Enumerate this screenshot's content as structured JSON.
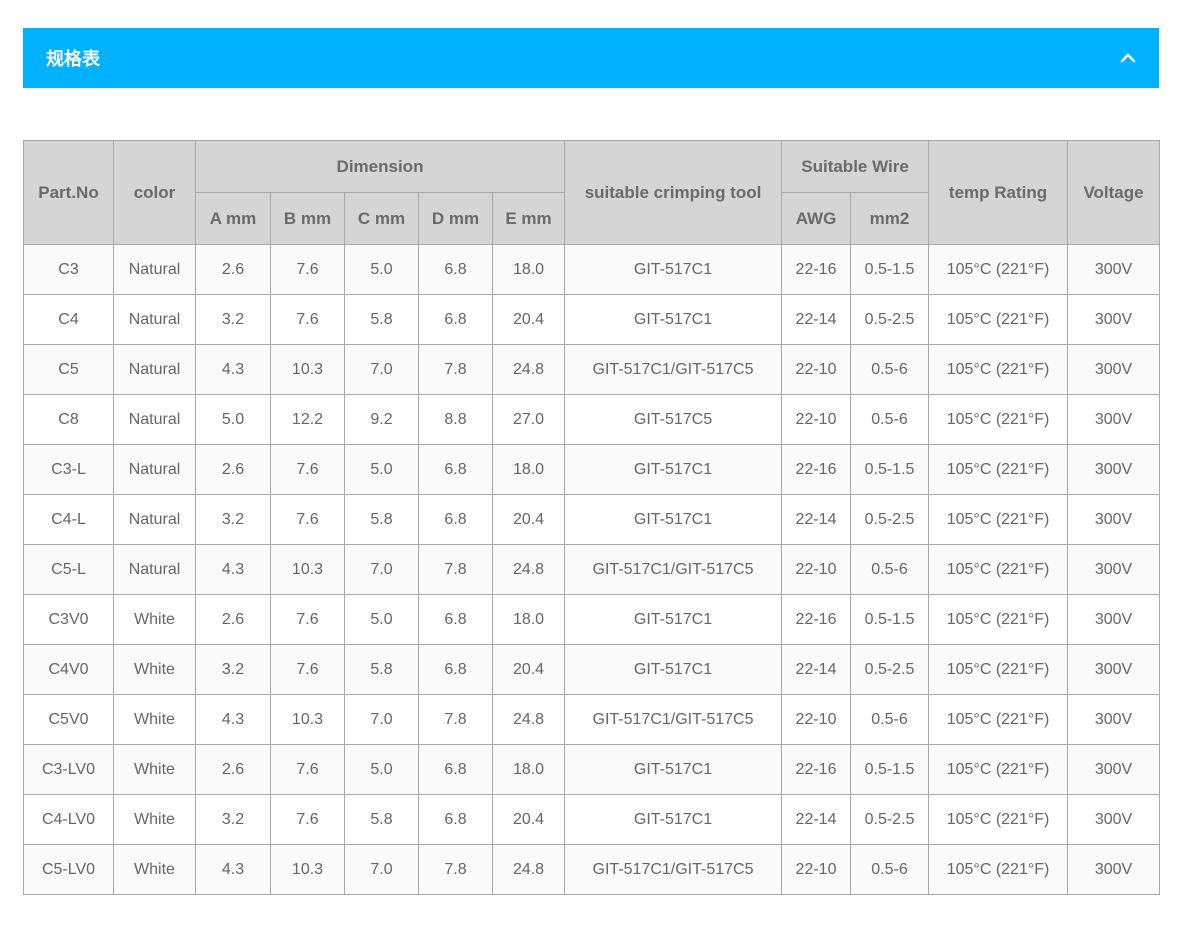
{
  "section": {
    "title": "规格表",
    "toggle_icon": "chevron-up-icon"
  },
  "colors": {
    "header_bg": "#00b1ff",
    "table_header_bg": "#d5d5d5",
    "border": "#a9a9a9"
  },
  "table": {
    "headers": {
      "part_no": "Part.No",
      "color": "color",
      "dimension": "Dimension",
      "crimp_tool": "suitable crimping tool",
      "suitable_wire": "Suitable Wire",
      "temp_rating": "temp Rating",
      "voltage": "Voltage",
      "a": "A mm",
      "b": "B mm",
      "c": "C mm",
      "d": "D mm",
      "e": "E mm",
      "awg": "AWG",
      "mm2": "mm2"
    },
    "rows": [
      [
        "C3",
        "Natural",
        "2.6",
        "7.6",
        "5.0",
        "6.8",
        "18.0",
        "GIT-517C1",
        "22-16",
        "0.5-1.5",
        "105°C (221°F)",
        "300V"
      ],
      [
        "C4",
        "Natural",
        "3.2",
        "7.6",
        "5.8",
        "6.8",
        "20.4",
        "GIT-517C1",
        "22-14",
        "0.5-2.5",
        "105°C (221°F)",
        "300V"
      ],
      [
        "C5",
        "Natural",
        "4.3",
        "10.3",
        "7.0",
        "7.8",
        "24.8",
        "GIT-517C1/GIT-517C5",
        "22-10",
        "0.5-6",
        "105°C (221°F)",
        "300V"
      ],
      [
        "C8",
        "Natural",
        "5.0",
        "12.2",
        "9.2",
        "8.8",
        "27.0",
        "GIT-517C5",
        "22-10",
        "0.5-6",
        "105°C (221°F)",
        "300V"
      ],
      [
        "C3-L",
        "Natural",
        "2.6",
        "7.6",
        "5.0",
        "6.8",
        "18.0",
        "GIT-517C1",
        "22-16",
        "0.5-1.5",
        "105°C (221°F)",
        "300V"
      ],
      [
        "C4-L",
        "Natural",
        "3.2",
        "7.6",
        "5.8",
        "6.8",
        "20.4",
        "GIT-517C1",
        "22-14",
        "0.5-2.5",
        "105°C (221°F)",
        "300V"
      ],
      [
        "C5-L",
        "Natural",
        "4.3",
        "10.3",
        "7.0",
        "7.8",
        "24.8",
        "GIT-517C1/GIT-517C5",
        "22-10",
        "0.5-6",
        "105°C (221°F)",
        "300V"
      ],
      [
        "C3V0",
        "White",
        "2.6",
        "7.6",
        "5.0",
        "6.8",
        "18.0",
        "GIT-517C1",
        "22-16",
        "0.5-1.5",
        "105°C (221°F)",
        "300V"
      ],
      [
        "C4V0",
        "White",
        "3.2",
        "7.6",
        "5.8",
        "6.8",
        "20.4",
        "GIT-517C1",
        "22-14",
        "0.5-2.5",
        "105°C (221°F)",
        "300V"
      ],
      [
        "C5V0",
        "White",
        "4.3",
        "10.3",
        "7.0",
        "7.8",
        "24.8",
        "GIT-517C1/GIT-517C5",
        "22-10",
        "0.5-6",
        "105°C (221°F)",
        "300V"
      ],
      [
        "C3-LV0",
        "White",
        "2.6",
        "7.6",
        "5.0",
        "6.8",
        "18.0",
        "GIT-517C1",
        "22-16",
        "0.5-1.5",
        "105°C (221°F)",
        "300V"
      ],
      [
        "C4-LV0",
        "White",
        "3.2",
        "7.6",
        "5.8",
        "6.8",
        "20.4",
        "GIT-517C1",
        "22-14",
        "0.5-2.5",
        "105°C (221°F)",
        "300V"
      ],
      [
        "C5-LV0",
        "White",
        "4.3",
        "10.3",
        "7.0",
        "7.8",
        "24.8",
        "GIT-517C1/GIT-517C5",
        "22-10",
        "0.5-6",
        "105°C (221°F)",
        "300V"
      ]
    ]
  }
}
